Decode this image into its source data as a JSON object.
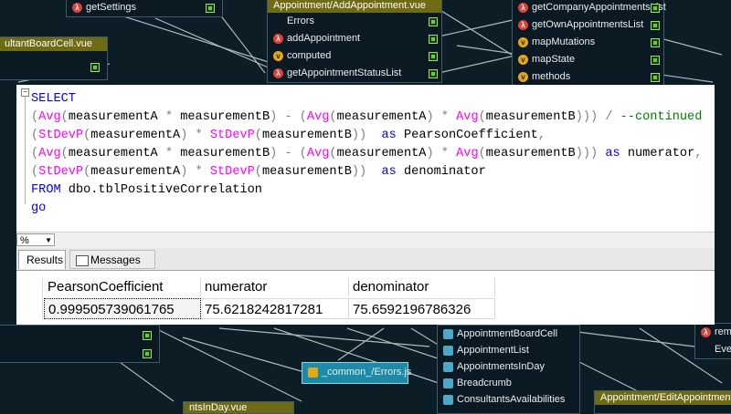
{
  "background": {
    "nodes": [
      {
        "title": "",
        "rows": [
          {
            "icon": "lambda",
            "label": "getSettings"
          }
        ]
      },
      {
        "title": "ultantBoardCell.vue",
        "rows": []
      },
      {
        "title": "Appointment/AddAppointment.vue",
        "rows": [
          {
            "icon": "",
            "label": "Errors"
          },
          {
            "icon": "lambda",
            "label": "addAppointment"
          },
          {
            "icon": "v",
            "label": "computed"
          },
          {
            "icon": "lambda",
            "label": "getAppointmentStatusList"
          }
        ]
      },
      {
        "title": "",
        "rows": [
          {
            "icon": "lambda",
            "label": "getCompanyAppointmentsList"
          },
          {
            "icon": "lambda",
            "label": "getOwnAppointmentsList"
          },
          {
            "icon": "v",
            "label": "mapMutations"
          },
          {
            "icon": "v",
            "label": "mapState"
          },
          {
            "icon": "v",
            "label": "methods"
          }
        ]
      },
      {
        "title": "",
        "rows": [
          {
            "icon": "",
            "label": "AppointmentBoardCell"
          },
          {
            "icon": "",
            "label": "AppointmentList"
          },
          {
            "icon": "",
            "label": "AppointmentsInDay"
          },
          {
            "icon": "",
            "label": "Breadcrumb"
          },
          {
            "icon": "",
            "label": "ConsultantsAvailabilities"
          }
        ]
      },
      {
        "title": "_common_/Errors.js",
        "rows": []
      },
      {
        "title": "Appointment/EditAppointment.vue",
        "rows": []
      },
      {
        "title": "",
        "rows": [
          {
            "icon": "lambda",
            "label": "removeOr"
          },
          {
            "icon": "",
            "label": "Eve"
          }
        ]
      },
      {
        "title": "ntsInDay.vue",
        "rows": []
      }
    ]
  },
  "editor": {
    "lines": [
      [
        {
          "c": "kw",
          "t": "SELECT"
        }
      ],
      [
        {
          "c": "op",
          "t": "("
        },
        {
          "c": "fn",
          "t": "Avg"
        },
        {
          "c": "op",
          "t": "("
        },
        {
          "c": "",
          "t": "measurementA "
        },
        {
          "c": "op",
          "t": "*"
        },
        {
          "c": "",
          "t": " measurementB"
        },
        {
          "c": "op",
          "t": ") - ("
        },
        {
          "c": "fn",
          "t": "Avg"
        },
        {
          "c": "op",
          "t": "("
        },
        {
          "c": "",
          "t": "measurementA"
        },
        {
          "c": "op",
          "t": ") * "
        },
        {
          "c": "fn",
          "t": "Avg"
        },
        {
          "c": "op",
          "t": "("
        },
        {
          "c": "",
          "t": "measurementB"
        },
        {
          "c": "op",
          "t": "))) / "
        },
        {
          "c": "cm",
          "t": "--continued"
        }
      ],
      [
        {
          "c": "op",
          "t": "("
        },
        {
          "c": "fn",
          "t": "StDevP"
        },
        {
          "c": "op",
          "t": "("
        },
        {
          "c": "",
          "t": "measurementA"
        },
        {
          "c": "op",
          "t": ") * "
        },
        {
          "c": "fn",
          "t": "StDevP"
        },
        {
          "c": "op",
          "t": "("
        },
        {
          "c": "",
          "t": "measurementB"
        },
        {
          "c": "op",
          "t": "))  "
        },
        {
          "c": "kw",
          "t": "as"
        },
        {
          "c": "",
          "t": " PearsonCoefficient"
        },
        {
          "c": "op",
          "t": ","
        }
      ],
      [
        {
          "c": "op",
          "t": "("
        },
        {
          "c": "fn",
          "t": "Avg"
        },
        {
          "c": "op",
          "t": "("
        },
        {
          "c": "",
          "t": "measurementA "
        },
        {
          "c": "op",
          "t": "*"
        },
        {
          "c": "",
          "t": " measurementB"
        },
        {
          "c": "op",
          "t": ") - ("
        },
        {
          "c": "fn",
          "t": "Avg"
        },
        {
          "c": "op",
          "t": "("
        },
        {
          "c": "",
          "t": "measurementA"
        },
        {
          "c": "op",
          "t": ") * "
        },
        {
          "c": "fn",
          "t": "Avg"
        },
        {
          "c": "op",
          "t": "("
        },
        {
          "c": "",
          "t": "measurementB"
        },
        {
          "c": "op",
          "t": "))) "
        },
        {
          "c": "kw",
          "t": "as"
        },
        {
          "c": "",
          "t": " numerator"
        },
        {
          "c": "op",
          "t": ","
        }
      ],
      [
        {
          "c": "op",
          "t": "("
        },
        {
          "c": "fn",
          "t": "StDevP"
        },
        {
          "c": "op",
          "t": "("
        },
        {
          "c": "",
          "t": "measurementA"
        },
        {
          "c": "op",
          "t": ") * "
        },
        {
          "c": "fn",
          "t": "StDevP"
        },
        {
          "c": "op",
          "t": "("
        },
        {
          "c": "",
          "t": "measurementB"
        },
        {
          "c": "op",
          "t": "))  "
        },
        {
          "c": "kw",
          "t": "as"
        },
        {
          "c": "",
          "t": " denominator"
        }
      ],
      [
        {
          "c": "kw",
          "t": "FROM"
        },
        {
          "c": "",
          "t": " dbo.tblPositiveCorrelation"
        }
      ],
      [
        {
          "c": "kw",
          "t": "go"
        }
      ]
    ],
    "colors": {
      "keyword": "#0000ff",
      "function": "#ff00ff",
      "operator": "#7f7f7f",
      "comment": "#008000"
    }
  },
  "zoom": {
    "value": "%"
  },
  "tabs": [
    {
      "label": "Results",
      "active": true
    },
    {
      "label": "Messages",
      "active": false
    }
  ],
  "results": {
    "columns": [
      "PearsonCoefficient",
      "numerator",
      "denominator"
    ],
    "rows": [
      [
        "0.999505739061765",
        "75.6218242817281",
        "75.6592196786326"
      ]
    ]
  }
}
